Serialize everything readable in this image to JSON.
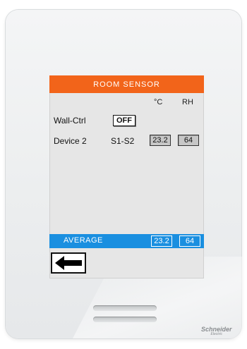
{
  "screen": {
    "title": "ROOM SENSOR",
    "units": {
      "temp": "°C",
      "humidity": "RH"
    },
    "wall_ctrl": {
      "label": "Wall-Ctrl",
      "button_label": "OFF"
    },
    "devices": [
      {
        "name": "Device 2",
        "sensors": "S1-S2",
        "temp": "23.2",
        "humidity": "64"
      }
    ],
    "average": {
      "label": "AVERAGE",
      "temp": "23.2",
      "humidity": "64"
    },
    "back_icon": "left-arrow-icon"
  },
  "brand": {
    "name": "Schneider",
    "sub": "Electric"
  },
  "colors": {
    "header": "#f2641a",
    "average_bar": "#1a8fe0",
    "screen_bg": "#e6e6e6",
    "value_box": "#c7c7c7"
  }
}
